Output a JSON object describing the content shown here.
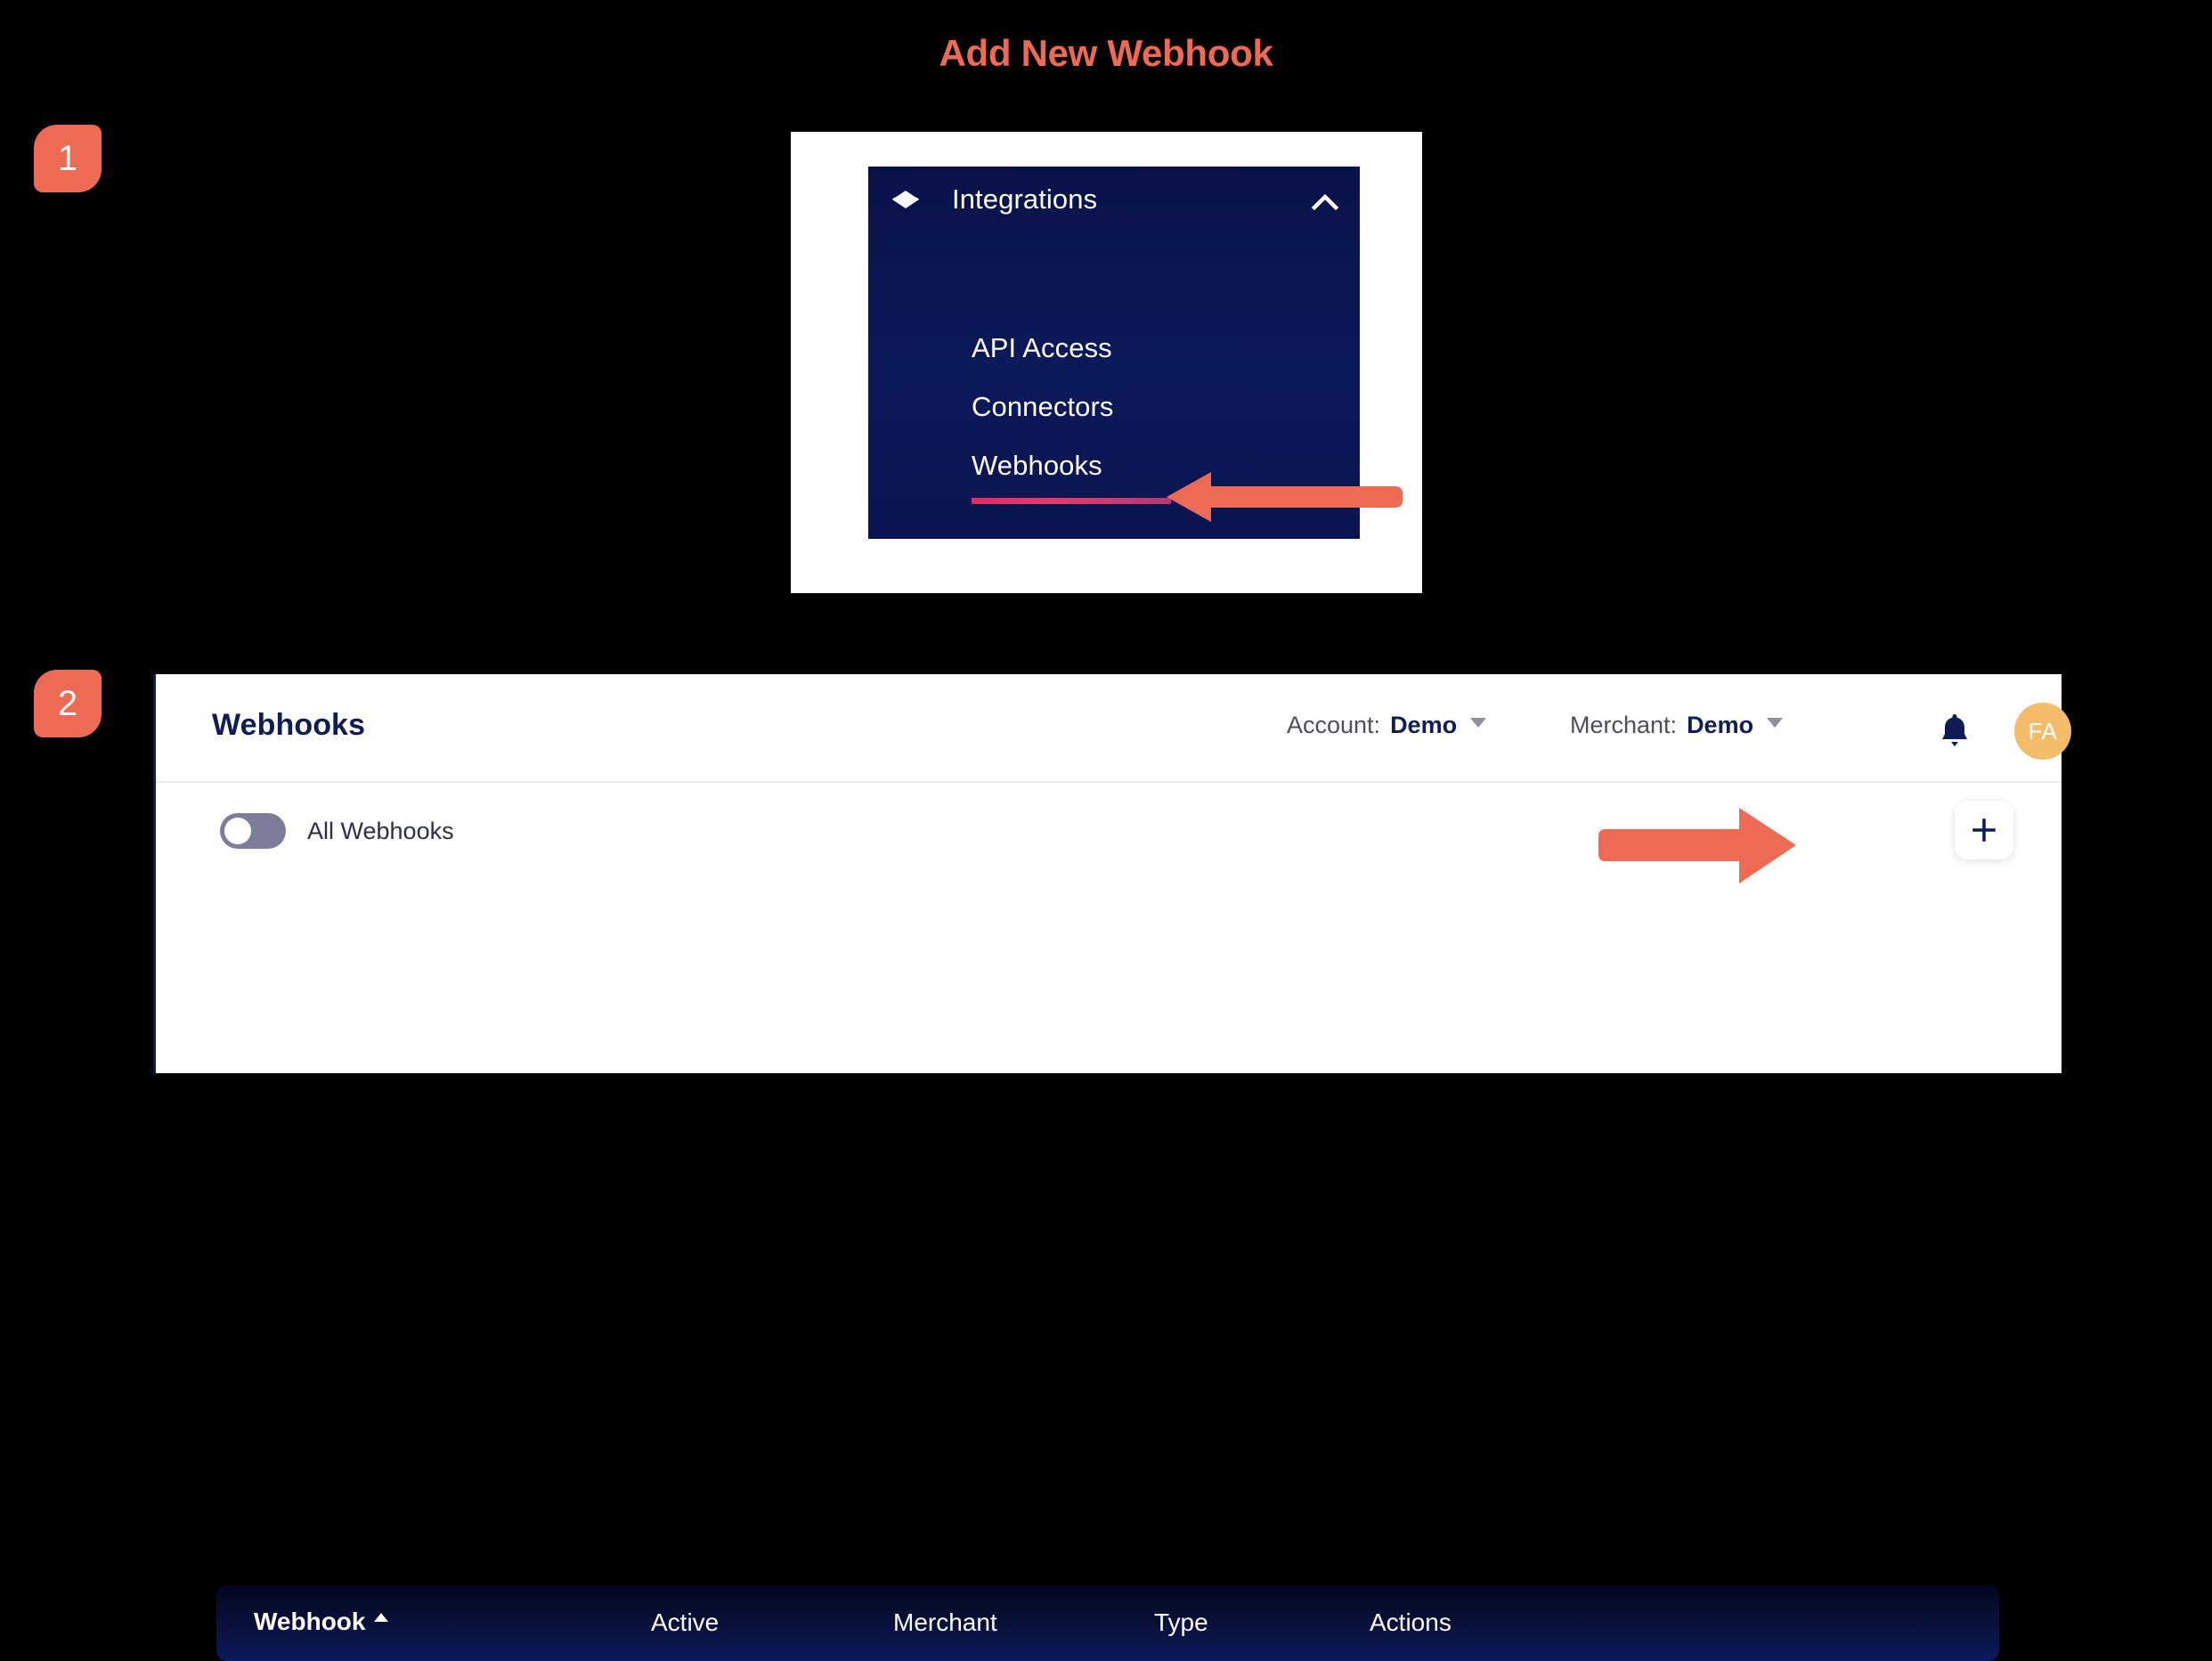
{
  "page": {
    "title": "Add New Webhook",
    "title_color": "#ef6a55",
    "background_color": "#000000"
  },
  "steps": [
    {
      "number": "1"
    },
    {
      "number": "2"
    }
  ],
  "annotations": {
    "arrow_color": "#ed6a55",
    "arrow_webhooks_name": "arrow-pointing-to-webhooks",
    "arrow_add_name": "arrow-pointing-to-add-button"
  },
  "step1_nav": {
    "group": {
      "label": "Integrations",
      "icon": "layers-icon",
      "chevron": "chevron-up-icon",
      "expanded": true
    },
    "items": [
      {
        "label": "API Access",
        "active": false
      },
      {
        "label": "Connectors",
        "active": false
      },
      {
        "label": "Webhooks",
        "active": true
      }
    ],
    "accent_color": "#e8396b",
    "panel_color": "#0b1450"
  },
  "step2_app": {
    "header": {
      "title": "Webhooks",
      "account": {
        "label": "Account:",
        "value": "Demo"
      },
      "merchant": {
        "label": "Merchant:",
        "value": "Demo"
      },
      "bell_icon": "bell-icon",
      "avatar_initials": "FA",
      "avatar_color": "#f3bc6b"
    },
    "toolbar": {
      "toggle_label": "All Webhooks",
      "toggle_state": "off",
      "add_button_icon": "plus-icon"
    },
    "table": {
      "columns": [
        {
          "label": "Webhook",
          "sorted": true,
          "sort_direction": "asc"
        },
        {
          "label": "Active",
          "sorted": false
        },
        {
          "label": "Merchant",
          "sorted": false
        },
        {
          "label": "Type",
          "sorted": false
        },
        {
          "label": "Actions",
          "sorted": false
        }
      ],
      "rows": []
    }
  }
}
